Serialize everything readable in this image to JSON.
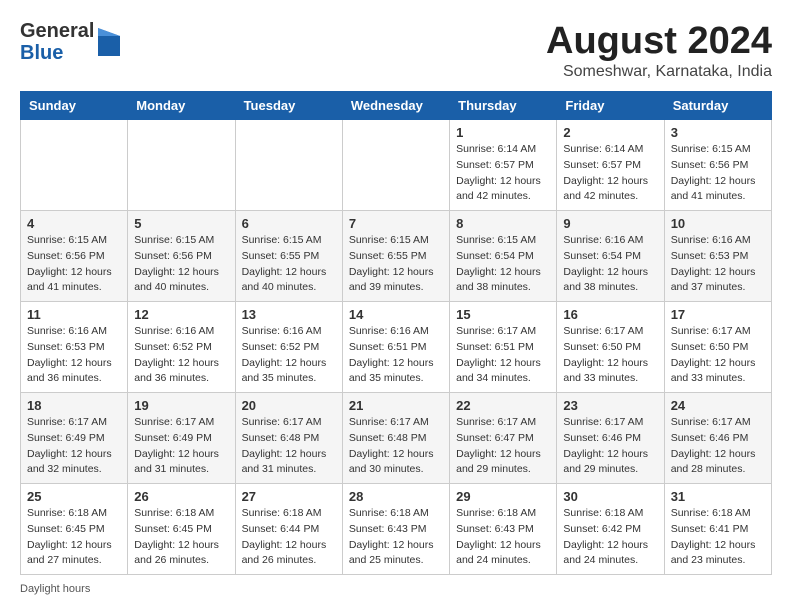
{
  "header": {
    "logo_general": "General",
    "logo_blue": "Blue",
    "month_title": "August 2024",
    "location": "Someshwar, Karnataka, India"
  },
  "calendar": {
    "days_of_week": [
      "Sunday",
      "Monday",
      "Tuesday",
      "Wednesday",
      "Thursday",
      "Friday",
      "Saturday"
    ],
    "weeks": [
      [
        {
          "day": "",
          "info": ""
        },
        {
          "day": "",
          "info": ""
        },
        {
          "day": "",
          "info": ""
        },
        {
          "day": "",
          "info": ""
        },
        {
          "day": "1",
          "info": "Sunrise: 6:14 AM\nSunset: 6:57 PM\nDaylight: 12 hours\nand 42 minutes."
        },
        {
          "day": "2",
          "info": "Sunrise: 6:14 AM\nSunset: 6:57 PM\nDaylight: 12 hours\nand 42 minutes."
        },
        {
          "day": "3",
          "info": "Sunrise: 6:15 AM\nSunset: 6:56 PM\nDaylight: 12 hours\nand 41 minutes."
        }
      ],
      [
        {
          "day": "4",
          "info": "Sunrise: 6:15 AM\nSunset: 6:56 PM\nDaylight: 12 hours\nand 41 minutes."
        },
        {
          "day": "5",
          "info": "Sunrise: 6:15 AM\nSunset: 6:56 PM\nDaylight: 12 hours\nand 40 minutes."
        },
        {
          "day": "6",
          "info": "Sunrise: 6:15 AM\nSunset: 6:55 PM\nDaylight: 12 hours\nand 40 minutes."
        },
        {
          "day": "7",
          "info": "Sunrise: 6:15 AM\nSunset: 6:55 PM\nDaylight: 12 hours\nand 39 minutes."
        },
        {
          "day": "8",
          "info": "Sunrise: 6:15 AM\nSunset: 6:54 PM\nDaylight: 12 hours\nand 38 minutes."
        },
        {
          "day": "9",
          "info": "Sunrise: 6:16 AM\nSunset: 6:54 PM\nDaylight: 12 hours\nand 38 minutes."
        },
        {
          "day": "10",
          "info": "Sunrise: 6:16 AM\nSunset: 6:53 PM\nDaylight: 12 hours\nand 37 minutes."
        }
      ],
      [
        {
          "day": "11",
          "info": "Sunrise: 6:16 AM\nSunset: 6:53 PM\nDaylight: 12 hours\nand 36 minutes."
        },
        {
          "day": "12",
          "info": "Sunrise: 6:16 AM\nSunset: 6:52 PM\nDaylight: 12 hours\nand 36 minutes."
        },
        {
          "day": "13",
          "info": "Sunrise: 6:16 AM\nSunset: 6:52 PM\nDaylight: 12 hours\nand 35 minutes."
        },
        {
          "day": "14",
          "info": "Sunrise: 6:16 AM\nSunset: 6:51 PM\nDaylight: 12 hours\nand 35 minutes."
        },
        {
          "day": "15",
          "info": "Sunrise: 6:17 AM\nSunset: 6:51 PM\nDaylight: 12 hours\nand 34 minutes."
        },
        {
          "day": "16",
          "info": "Sunrise: 6:17 AM\nSunset: 6:50 PM\nDaylight: 12 hours\nand 33 minutes."
        },
        {
          "day": "17",
          "info": "Sunrise: 6:17 AM\nSunset: 6:50 PM\nDaylight: 12 hours\nand 33 minutes."
        }
      ],
      [
        {
          "day": "18",
          "info": "Sunrise: 6:17 AM\nSunset: 6:49 PM\nDaylight: 12 hours\nand 32 minutes."
        },
        {
          "day": "19",
          "info": "Sunrise: 6:17 AM\nSunset: 6:49 PM\nDaylight: 12 hours\nand 31 minutes."
        },
        {
          "day": "20",
          "info": "Sunrise: 6:17 AM\nSunset: 6:48 PM\nDaylight: 12 hours\nand 31 minutes."
        },
        {
          "day": "21",
          "info": "Sunrise: 6:17 AM\nSunset: 6:48 PM\nDaylight: 12 hours\nand 30 minutes."
        },
        {
          "day": "22",
          "info": "Sunrise: 6:17 AM\nSunset: 6:47 PM\nDaylight: 12 hours\nand 29 minutes."
        },
        {
          "day": "23",
          "info": "Sunrise: 6:17 AM\nSunset: 6:46 PM\nDaylight: 12 hours\nand 29 minutes."
        },
        {
          "day": "24",
          "info": "Sunrise: 6:17 AM\nSunset: 6:46 PM\nDaylight: 12 hours\nand 28 minutes."
        }
      ],
      [
        {
          "day": "25",
          "info": "Sunrise: 6:18 AM\nSunset: 6:45 PM\nDaylight: 12 hours\nand 27 minutes."
        },
        {
          "day": "26",
          "info": "Sunrise: 6:18 AM\nSunset: 6:45 PM\nDaylight: 12 hours\nand 26 minutes."
        },
        {
          "day": "27",
          "info": "Sunrise: 6:18 AM\nSunset: 6:44 PM\nDaylight: 12 hours\nand 26 minutes."
        },
        {
          "day": "28",
          "info": "Sunrise: 6:18 AM\nSunset: 6:43 PM\nDaylight: 12 hours\nand 25 minutes."
        },
        {
          "day": "29",
          "info": "Sunrise: 6:18 AM\nSunset: 6:43 PM\nDaylight: 12 hours\nand 24 minutes."
        },
        {
          "day": "30",
          "info": "Sunrise: 6:18 AM\nSunset: 6:42 PM\nDaylight: 12 hours\nand 24 minutes."
        },
        {
          "day": "31",
          "info": "Sunrise: 6:18 AM\nSunset: 6:41 PM\nDaylight: 12 hours\nand 23 minutes."
        }
      ]
    ]
  },
  "footer": {
    "note": "Daylight hours"
  }
}
